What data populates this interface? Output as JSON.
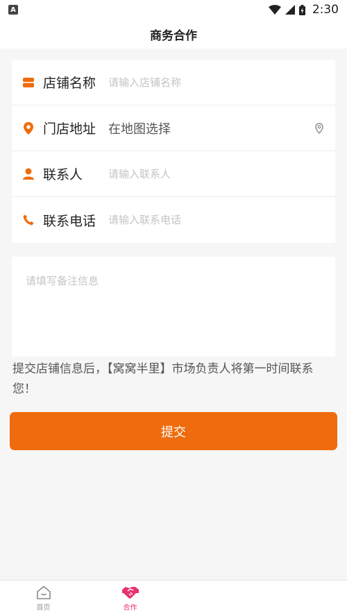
{
  "status": {
    "time": "2:30",
    "badge": "A"
  },
  "header": {
    "title": "商务合作"
  },
  "form": {
    "store_name": {
      "label": "店铺名称",
      "placeholder": "请输入店铺名称"
    },
    "address": {
      "label": "门店地址",
      "value": "在地图选择"
    },
    "contact": {
      "label": "联系人",
      "placeholder": "请输入联系人"
    },
    "phone": {
      "label": "联系电话",
      "placeholder": "请输入联系电话"
    },
    "remarks": {
      "placeholder": "请填写备注信息"
    }
  },
  "notice": "提交店铺信息后，【窝窝半里】市场负责人将第一时间联系您！",
  "submit_label": "提交",
  "tabs": [
    {
      "label": "首页",
      "icon": "home-icon"
    },
    {
      "label": "合作",
      "icon": "handshake-icon"
    },
    {
      "label": "",
      "icon": ""
    },
    {
      "label": "",
      "icon": ""
    }
  ],
  "colors": {
    "accent": "#ee6c0e",
    "tab_active": "#e8336c"
  }
}
